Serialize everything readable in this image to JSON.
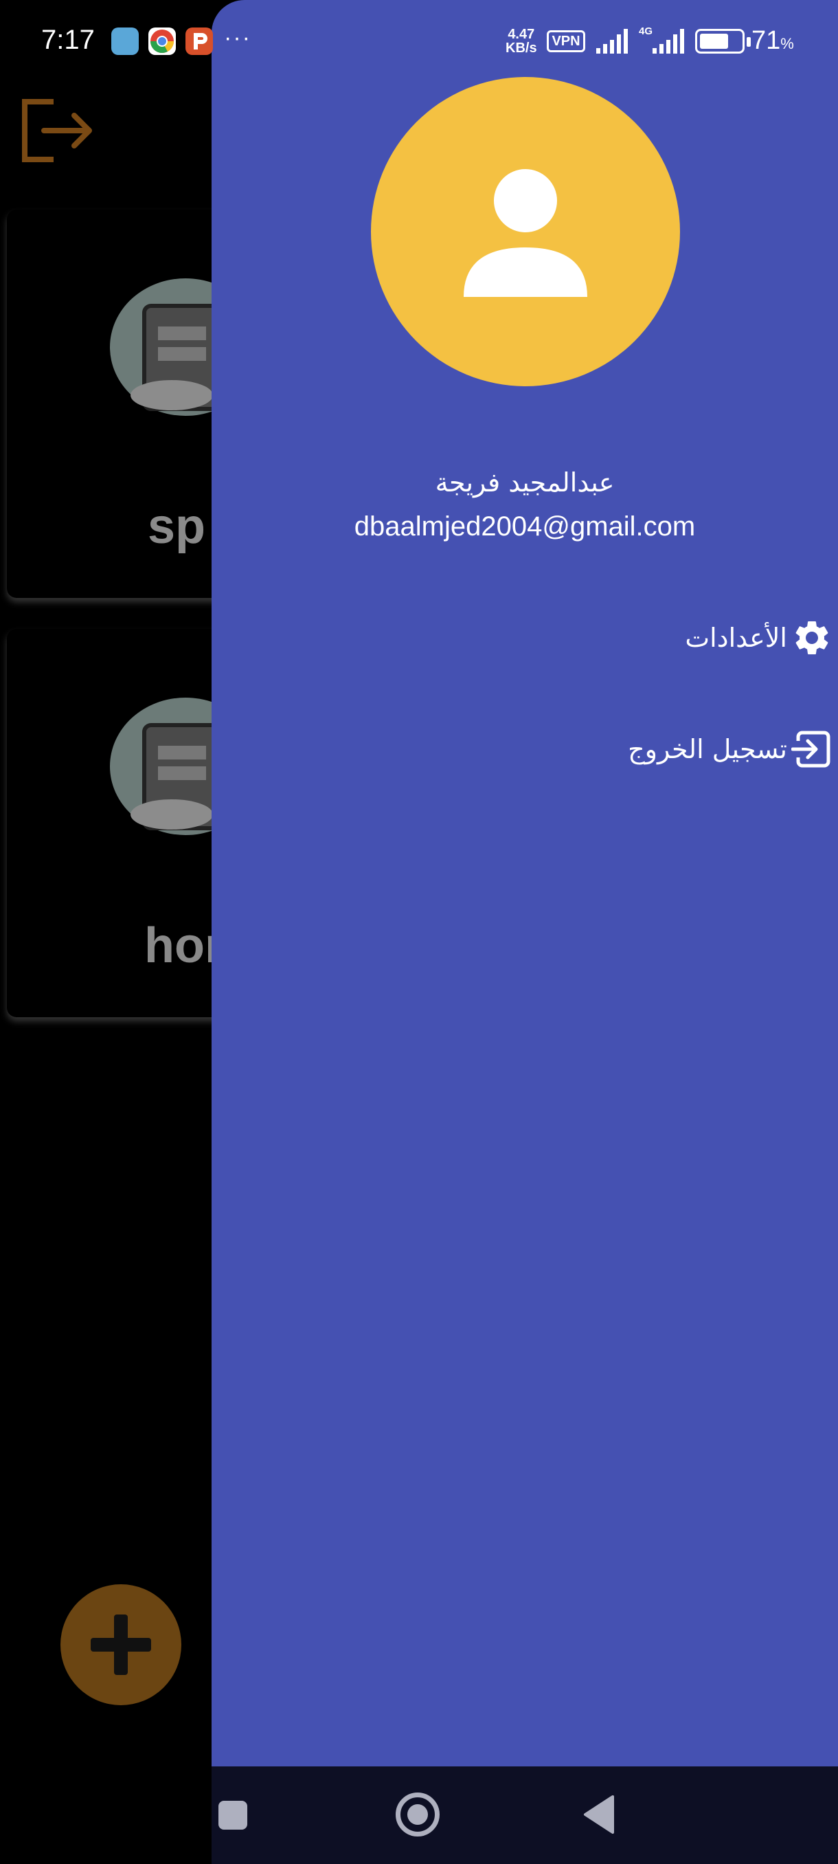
{
  "status_bar": {
    "time": "7:17",
    "net_speed_value": "4.47",
    "net_speed_unit": "KB/s",
    "vpn_label": "VPN",
    "network_type": "4G",
    "battery_percent": "71",
    "battery_percent_sign": "%",
    "battery_level": 0.71,
    "overflow": "···",
    "notification_icons": [
      "telegram-icon",
      "chrome-icon",
      "p-app-icon"
    ]
  },
  "background_app": {
    "cards": [
      {
        "label": "sp"
      },
      {
        "label": "hor"
      }
    ],
    "accent_color": "#6b4512"
  },
  "drawer": {
    "background_color": "#4551b2",
    "avatar_color": "#f4c142",
    "user_name": "عبدالمجيد فريجة",
    "user_email": "dbaalmjed2004@gmail.com",
    "menu": [
      {
        "label": "الأعدادات",
        "icon": "gear-icon"
      },
      {
        "label": "تسجيل الخروج",
        "icon": "logout-icon"
      }
    ]
  },
  "nav_bar": {
    "buttons": [
      "recents",
      "home",
      "back"
    ]
  }
}
